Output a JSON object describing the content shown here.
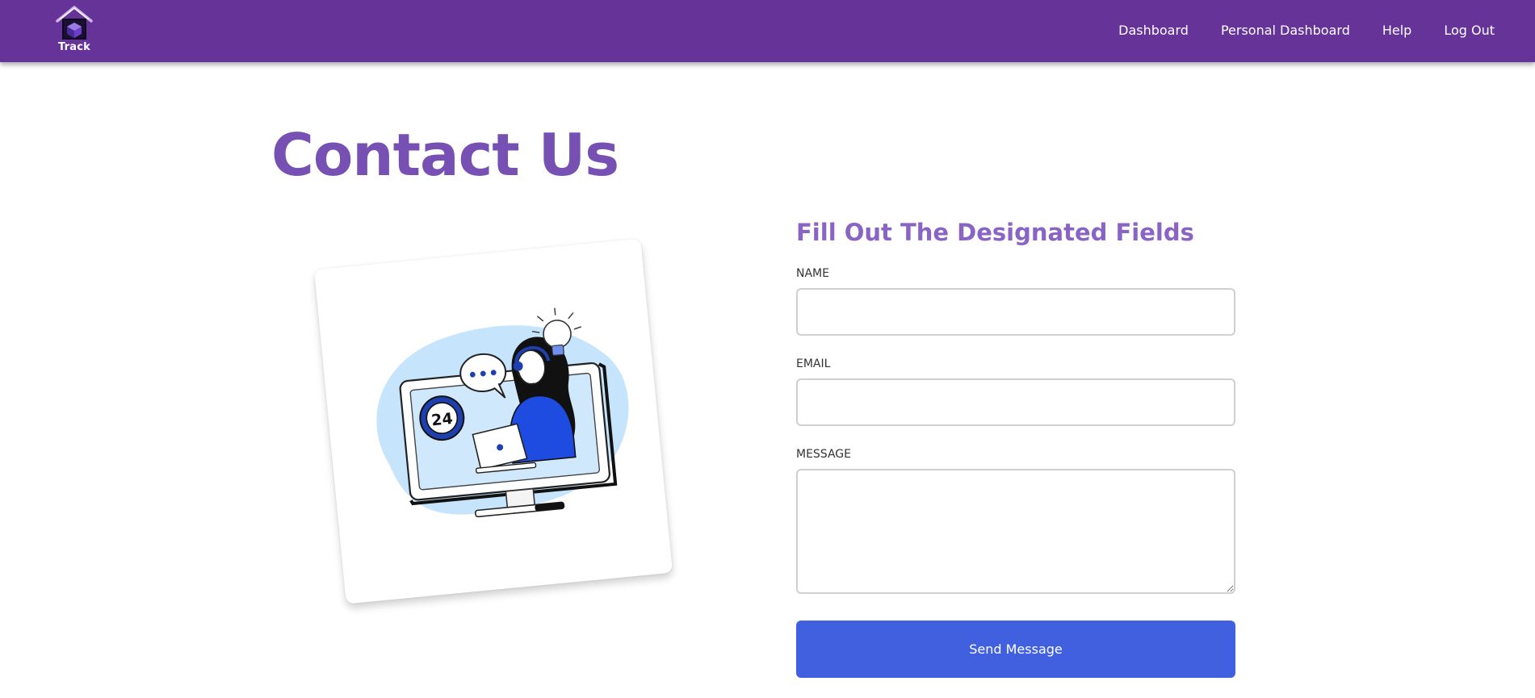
{
  "navbar": {
    "brand": {
      "text": "Track",
      "icon": "house-logo-icon"
    },
    "links": [
      {
        "label": "Dashboard"
      },
      {
        "label": "Personal Dashboard"
      },
      {
        "label": "Help"
      },
      {
        "label": "Log Out"
      }
    ],
    "background_color": "#663399"
  },
  "main": {
    "title": "Contact Us",
    "title_color": "#7650b3",
    "illustration": {
      "icon": "customer-support-illustration",
      "badge_text": "24"
    },
    "form": {
      "title": "Fill Out The Designated Fields",
      "fields": {
        "name": {
          "label": "NAME",
          "value": "",
          "placeholder": ""
        },
        "email": {
          "label": "EMAIL",
          "value": "",
          "placeholder": ""
        },
        "message": {
          "label": "MESSAGE",
          "value": "",
          "placeholder": ""
        }
      },
      "submit_label": "Send Message",
      "submit_color": "#4160e0"
    }
  }
}
